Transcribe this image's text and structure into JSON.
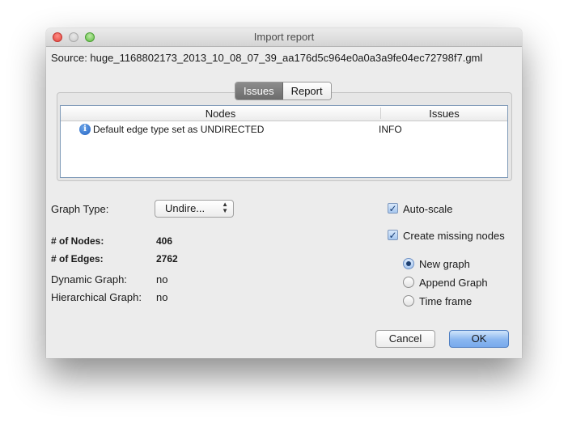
{
  "window": {
    "title": "Import report"
  },
  "source": "Source: huge_1168802173_2013_10_08_07_39_aa176d5c964e0a0a3a9fe04ec72798f7.gml",
  "tabs": [
    {
      "label": "Issues",
      "selected": true
    },
    {
      "label": "Report",
      "selected": false
    }
  ],
  "table": {
    "columns": [
      "Nodes",
      "Issues"
    ],
    "rows": [
      {
        "icon": "info-icon",
        "message": "Default edge type set as UNDIRECTED",
        "level": "INFO"
      }
    ]
  },
  "graph_type": {
    "label": "Graph Type:",
    "value": "Undire..."
  },
  "stats": {
    "nodes_label": "# of Nodes:",
    "nodes_value": "406",
    "edges_label": "# of Edges:",
    "edges_value": "2762",
    "dynamic_label": "Dynamic Graph:",
    "dynamic_value": "no",
    "hierarchical_label": "Hierarchical Graph:",
    "hierarchical_value": "no"
  },
  "options": {
    "auto_scale": {
      "label": "Auto-scale",
      "checked": true
    },
    "create_missing": {
      "label": "Create missing nodes",
      "checked": true
    }
  },
  "modes": [
    {
      "label": "New graph",
      "selected": true
    },
    {
      "label": "Append Graph",
      "selected": false
    },
    {
      "label": "Time frame",
      "selected": false
    }
  ],
  "buttons": {
    "cancel": "Cancel",
    "ok": "OK"
  },
  "colors": {
    "accent": "#78a9ec",
    "window_bg": "#ececec"
  }
}
